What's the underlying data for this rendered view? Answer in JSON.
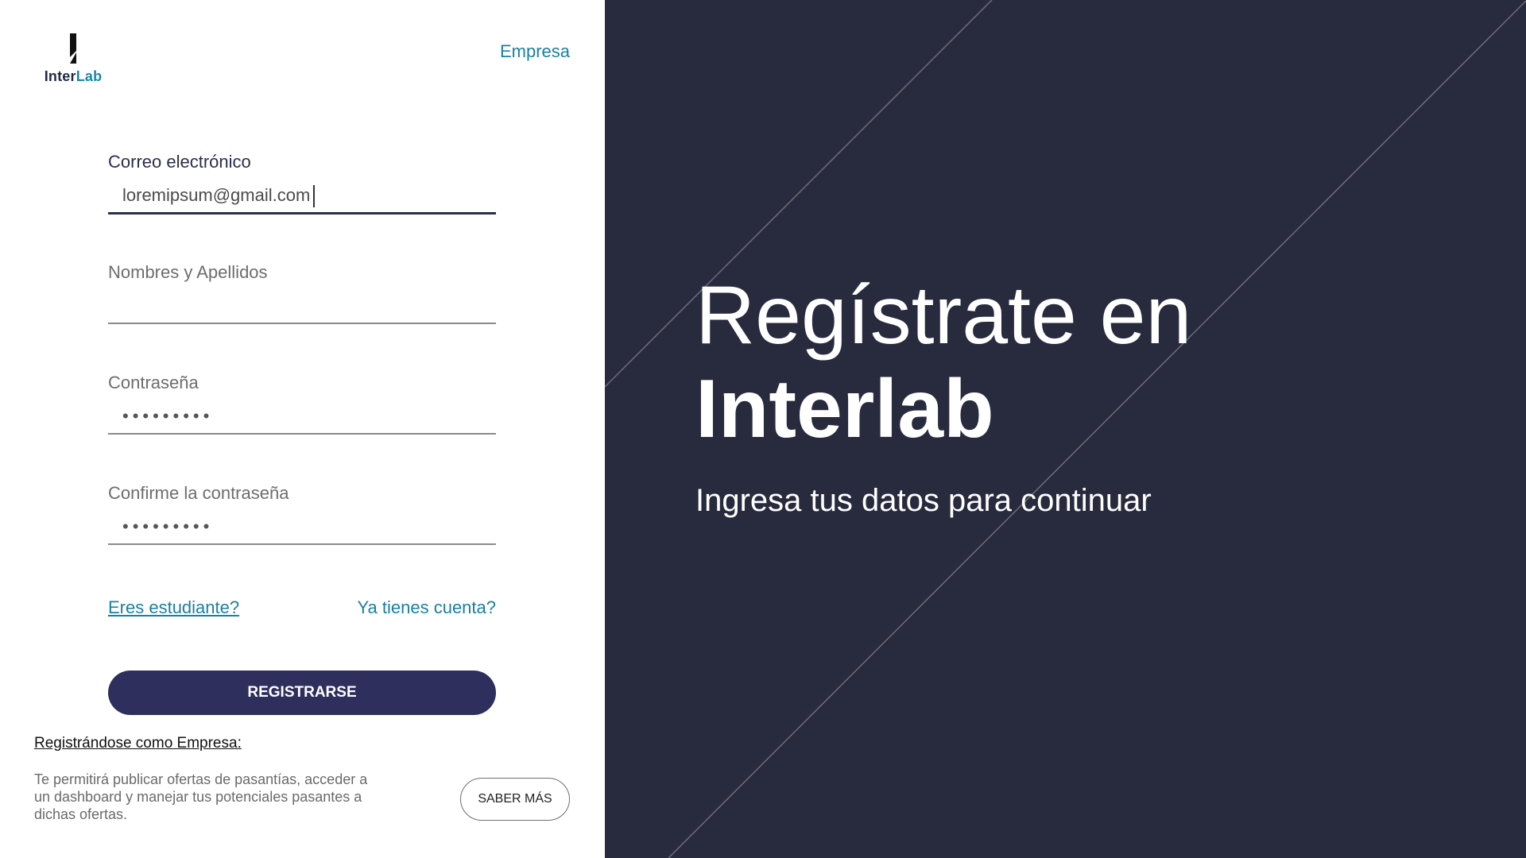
{
  "brand": {
    "name_part1": "Inter",
    "name_part2": "Lab"
  },
  "header": {
    "empresa_link": "Empresa"
  },
  "form": {
    "email": {
      "label": "Correo electrónico",
      "value": "loremipsum@gmail.com"
    },
    "name": {
      "label": "Nombres y Apellidos",
      "value": ""
    },
    "password": {
      "label": "Contraseña",
      "value": "•••••••••"
    },
    "confirm_password": {
      "label": "Confirme la contraseña",
      "value": "•••••••••"
    },
    "student_link": "Eres estudiante?",
    "account_link": "Ya tienes cuenta?",
    "register_button": "REGISTRARSE"
  },
  "company": {
    "title": "Registrándose como Empresa:",
    "description": "Te permitirá publicar ofertas de pasantías, acceder a un dashboard y manejar tus potenciales pasantes a dichas ofertas.",
    "more_button": "SABER MÁS"
  },
  "hero": {
    "line1": "Regístrate en",
    "line2": "Interlab",
    "subtitle": "Ingresa tus datos para continuar"
  },
  "colors": {
    "accent": "#1b7fa1",
    "button": "#2e2f5d",
    "panel": "#282a3e"
  },
  "icons": {
    "logo": "interlab-logo-icon"
  }
}
